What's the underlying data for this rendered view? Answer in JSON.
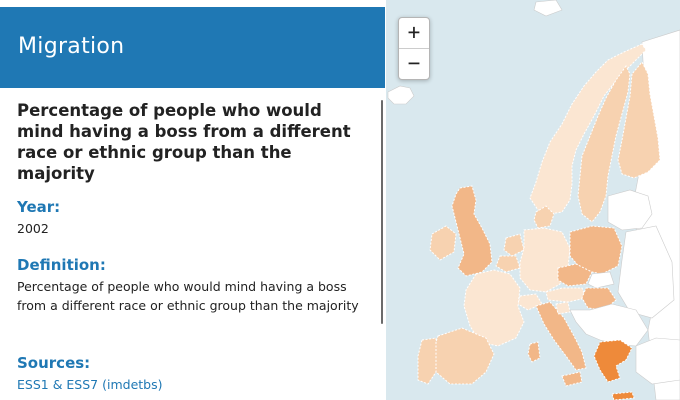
{
  "header": {
    "title": "Migration"
  },
  "panel": {
    "title": "Percentage of people who would mind having a boss from a different race or ethnic group than the majority",
    "year_label": "Year:",
    "year_value": "2002",
    "definition_label": "Definition:",
    "definition_text": "Percentage of people who would mind having a boss from a different race or ethnic group than the majority",
    "sources_label": "Sources:",
    "sources_link": "ESS1 & ESS7 (imdetbs)"
  },
  "map": {
    "zoom_in_label": "+",
    "zoom_out_label": "−",
    "colors": {
      "sea": "#d9e8ee",
      "no_data": "#ffffff",
      "lightest": "#fbe6d2",
      "light": "#f7d2b0",
      "medium": "#f2b788",
      "strong": "#ee8a3a",
      "border": "#ffffff"
    }
  }
}
